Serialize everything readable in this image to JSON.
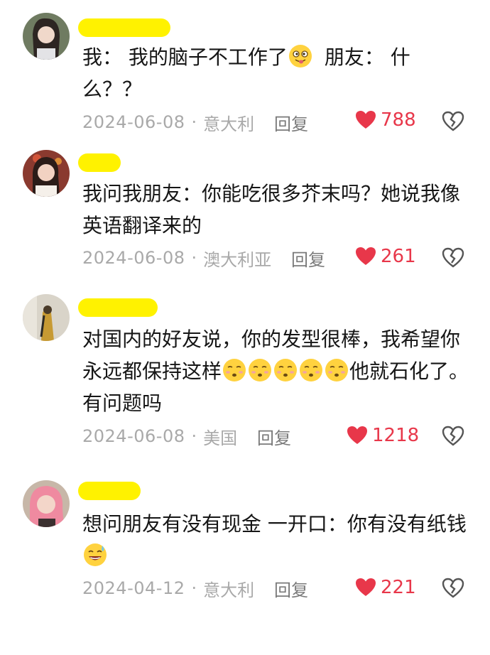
{
  "comments": [
    {
      "text_parts": [
        "我： 我的脑子不工作了",
        "朋友： 什么？？"
      ],
      "date": "2024-06-08",
      "location": "意大利",
      "reply_label": "回复",
      "likes": "788"
    },
    {
      "text": "我问我朋友：你能吃很多芥末吗？她说我像英语翻译来的",
      "date": "2024-06-08",
      "location": "澳大利亚",
      "reply_label": "回复",
      "likes": "261"
    },
    {
      "text_parts": [
        "对国内的好友说，你的发型很棒，我希望你永远都保持这样",
        "他就石化了。有问题吗"
      ],
      "date": "2024-06-08",
      "location": "美国",
      "reply_label": "回复",
      "likes": "1218"
    },
    {
      "text": "想问朋友有没有现金 一开口：你有没有纸钱",
      "date": "2024-04-12",
      "location": "意大利",
      "reply_label": "回复",
      "likes": "221"
    }
  ],
  "meta_separator": "·",
  "colors": {
    "like": "#e8374a",
    "redaction": "#fff200",
    "meta": "#a9a9a9"
  }
}
